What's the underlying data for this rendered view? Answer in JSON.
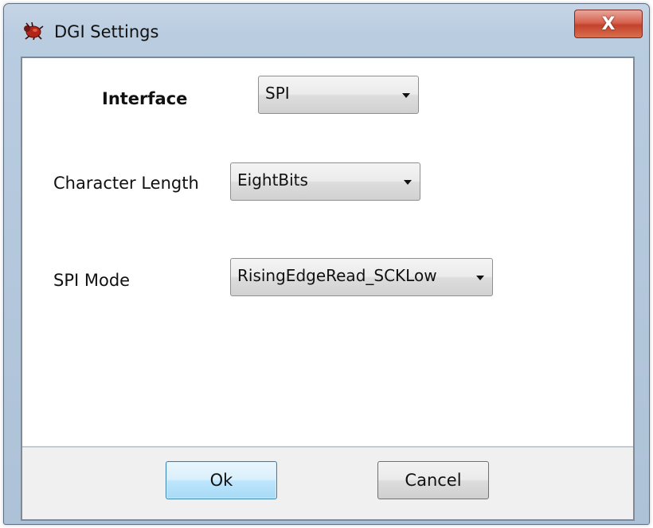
{
  "window": {
    "title": "DGI Settings",
    "icon": "red-bug-icon",
    "close_glyph": "X"
  },
  "form": {
    "interface": {
      "label": "Interface",
      "value": "SPI"
    },
    "character_length": {
      "label": "Character Length",
      "value": "EightBits"
    },
    "spi_mode": {
      "label": "SPI Mode",
      "value": "RisingEdgeRead_SCKLow"
    }
  },
  "buttons": {
    "ok": "Ok",
    "cancel": "Cancel"
  },
  "colors": {
    "close_button": "#c3422c",
    "default_button": "#bee6fd",
    "title_bar": "#b9cce0"
  }
}
